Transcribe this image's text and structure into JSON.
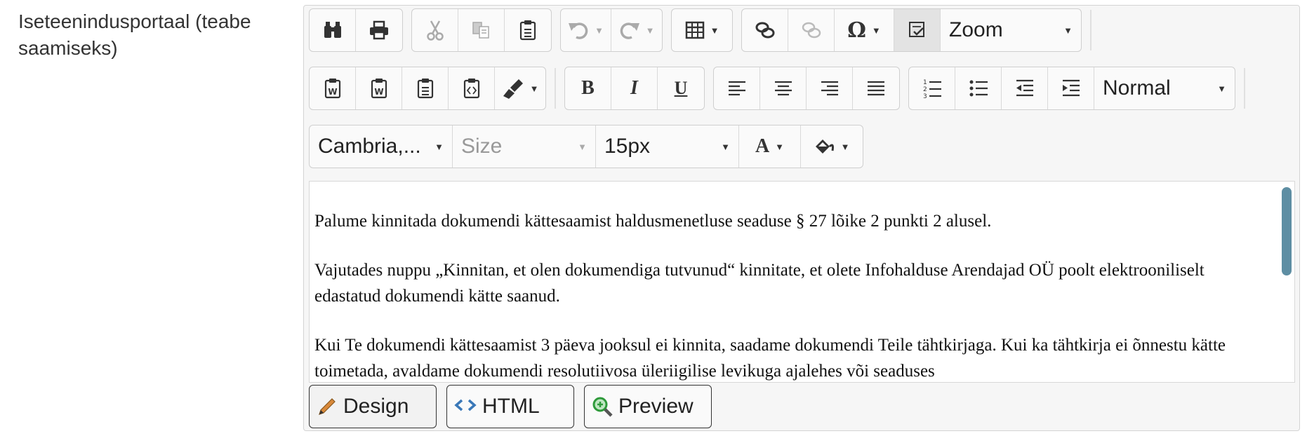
{
  "field": {
    "label": "Iseteenindusportaal (teabe saamiseks)"
  },
  "toolbar": {
    "zoom": "Zoom",
    "paragraph_format": "Normal",
    "font_name": "Cambria,...",
    "font_size_placeholder": "Size",
    "line_height": "15px",
    "icons": {
      "find": "binoculars-icon",
      "print": "printer-icon",
      "cut": "scissors-icon",
      "copy": "copy-icon",
      "paste": "clipboard-icon",
      "undo": "undo-icon",
      "redo": "redo-icon",
      "table": "table-icon",
      "link": "link-icon",
      "unlink": "unlink-icon",
      "symbol": "omega-icon",
      "spellcheck": "spellcheck-icon",
      "paste_word": "paste-word-icon",
      "paste_text": "paste-text-icon",
      "paste_plain": "paste-plain-icon",
      "paste_html": "paste-html-icon",
      "format_painter": "brush-icon",
      "bold": "B",
      "italic": "I",
      "underline": "U",
      "forecolor": "A"
    }
  },
  "document": {
    "paragraphs": [
      "Palume kinnitada dokumendi kättesaamist haldusmenetluse seaduse § 27 lõike 2 punkti 2 alusel.",
      "Vajutades nuppu „Kinnitan, et olen dokumendiga tutvunud“ kinnitate, et olete Infohalduse Arendajad OÜ poolt elektrooniliselt edastatud dokumendi kätte saanud.",
      "Kui Te dokumendi kättesaamist 3 päeva jooksul ei kinnita, saadame dokumendi Teile tähtkirjaga. Kui ka tähtkirja ei õnnestu kätte toimetada, avaldame dokumendi resolutiivosa üleriigilise levikuga ajalehes või seaduses"
    ]
  },
  "modes": {
    "design": "Design",
    "html": "HTML",
    "preview": "Preview"
  },
  "colors": {
    "scrollbar": "#5e8ea3",
    "html_icon": "#3a78b8",
    "preview_icon": "#2e9a3a",
    "pencil": "#d9893a"
  }
}
